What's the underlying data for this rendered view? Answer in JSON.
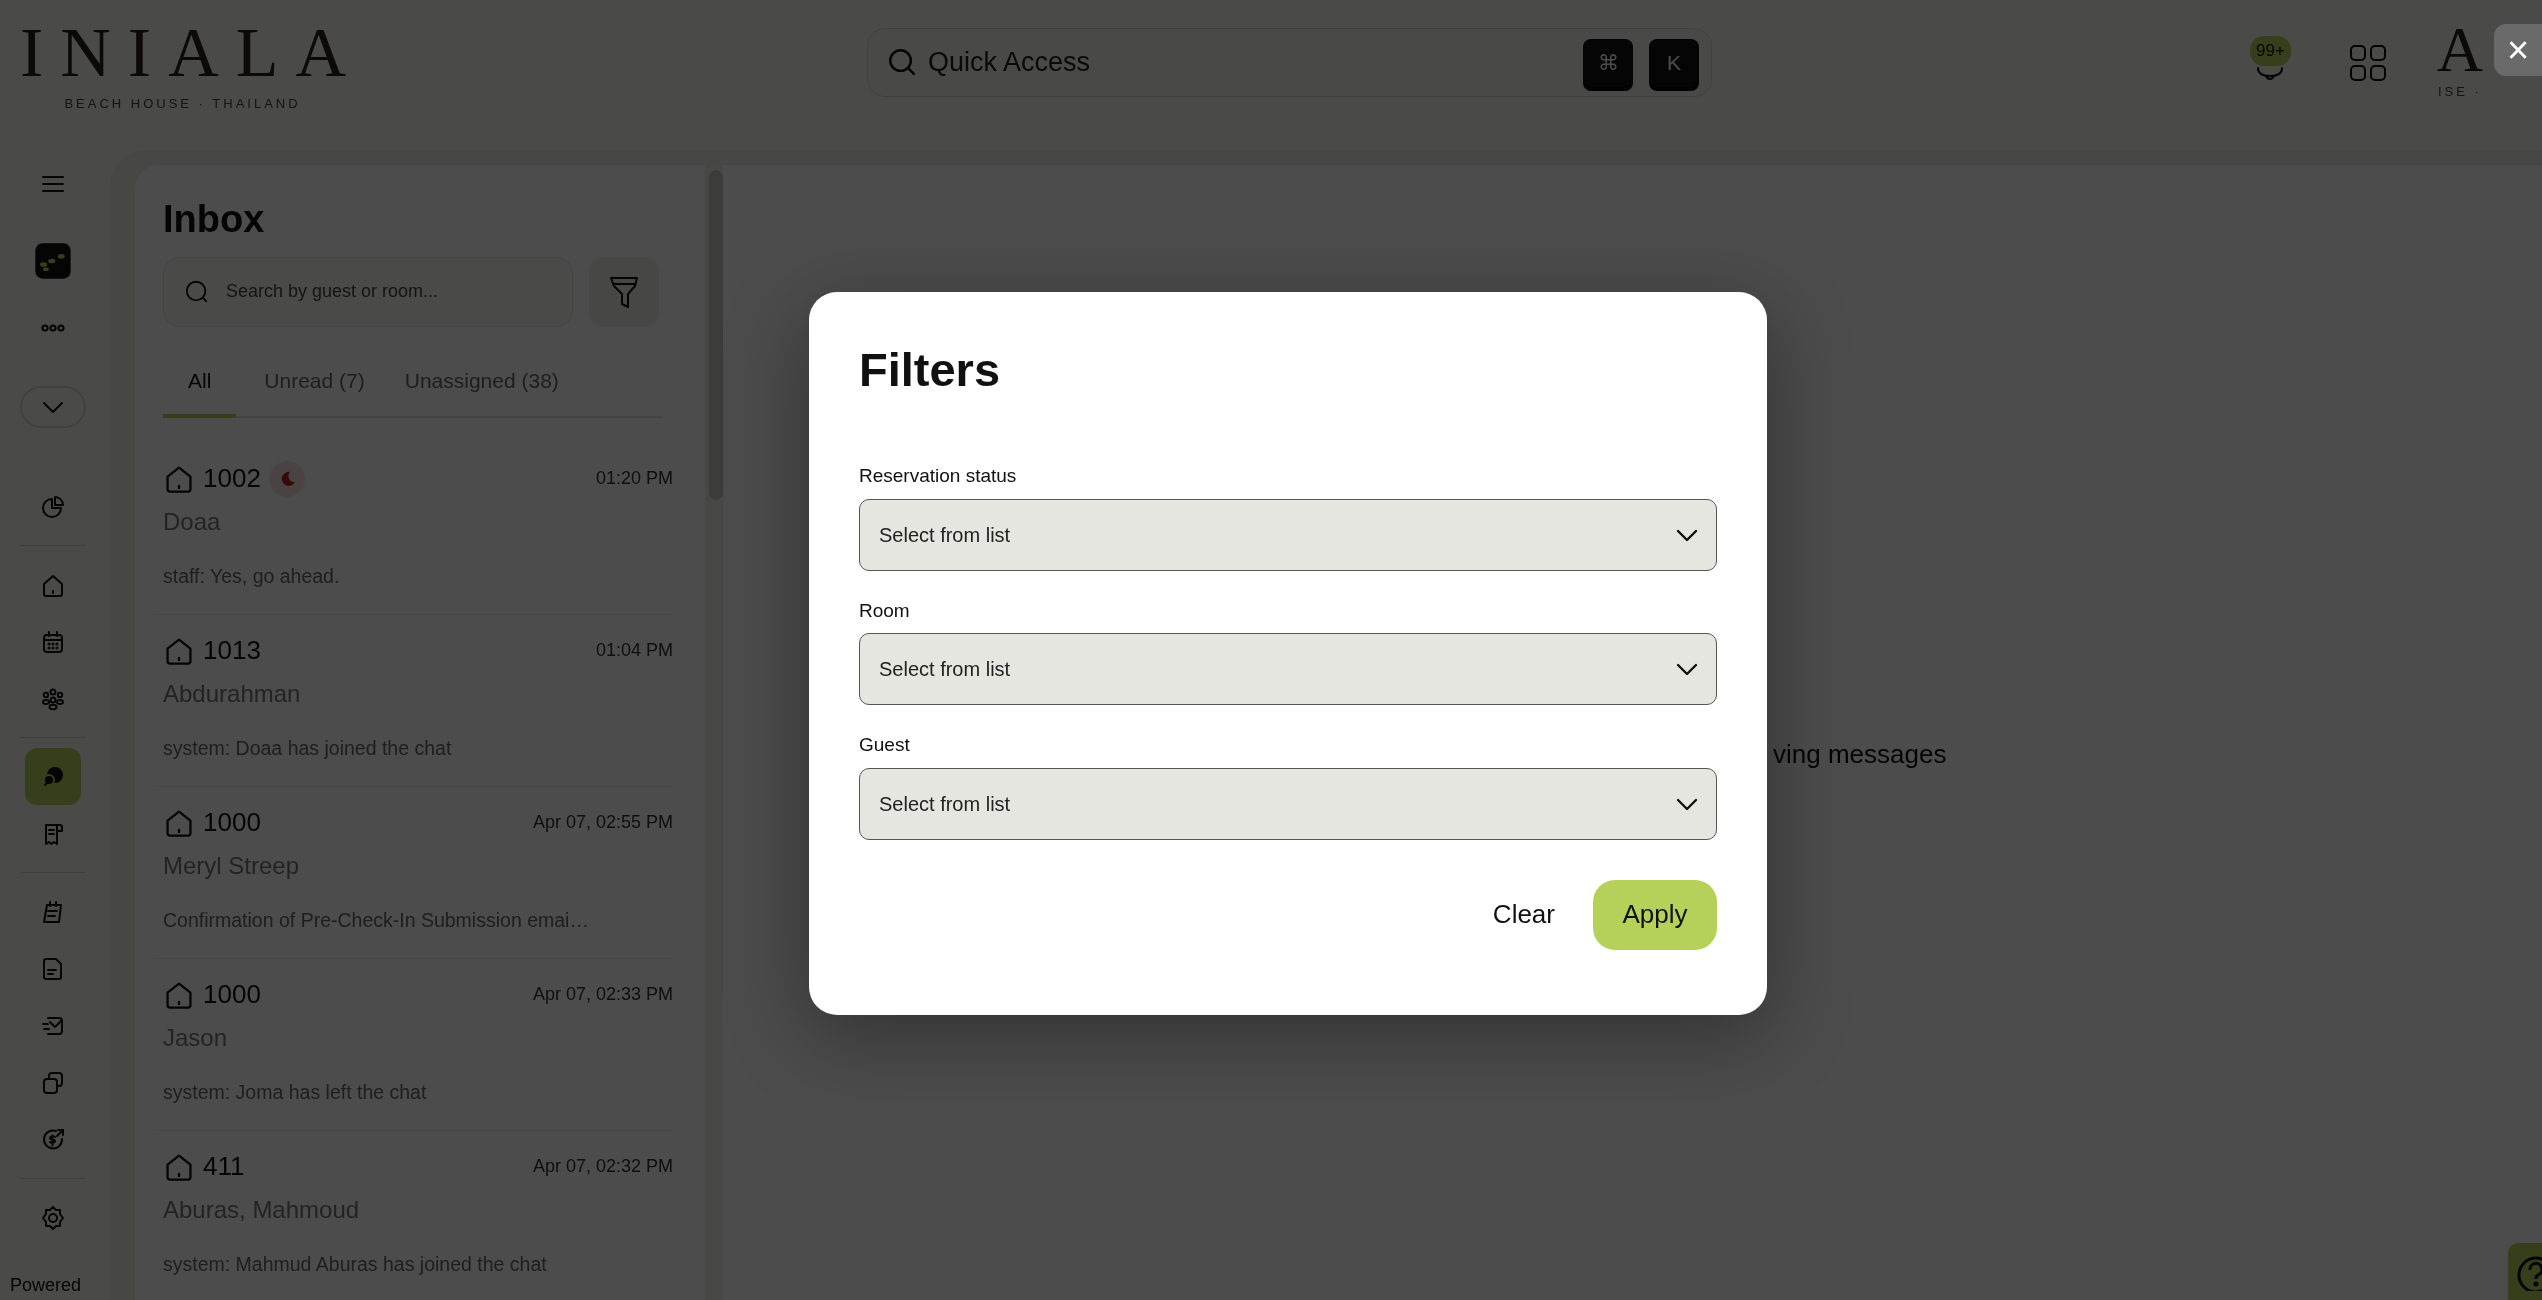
{
  "logo": {
    "name": "INIALA",
    "tagline": "BEACH HOUSE · THAILAND"
  },
  "quick_access": {
    "placeholder": "Quick Access",
    "keys": [
      "⌘",
      "K"
    ]
  },
  "header_right": {
    "notification_badge": "99+",
    "partial_logo_letter": "A",
    "partial_logo_tagline": "ISE ·"
  },
  "close_button": "×",
  "sidebar": {
    "items": [
      {
        "kind": "menu",
        "selected": false
      },
      {
        "kind": "app",
        "selected": false
      },
      {
        "kind": "more",
        "selected": false
      },
      {
        "kind": "collapse"
      },
      {
        "kind": "chart",
        "selected": false
      },
      {
        "kind": "divider"
      },
      {
        "kind": "home",
        "selected": false
      },
      {
        "kind": "calendar",
        "selected": false
      },
      {
        "kind": "guests",
        "selected": false
      },
      {
        "kind": "divider"
      },
      {
        "kind": "chat",
        "selected": true
      },
      {
        "kind": "receipt",
        "selected": false
      },
      {
        "kind": "divider"
      },
      {
        "kind": "notes",
        "selected": false
      },
      {
        "kind": "document",
        "selected": false
      },
      {
        "kind": "mail",
        "selected": false
      },
      {
        "kind": "copy",
        "selected": false
      },
      {
        "kind": "payment",
        "selected": false
      },
      {
        "kind": "divider"
      },
      {
        "kind": "settings",
        "selected": false
      }
    ],
    "footer": "Powered"
  },
  "inbox": {
    "title": "Inbox",
    "search": {
      "placeholder": "Search by guest or room..."
    },
    "tabs": [
      {
        "label": "All",
        "selected": true
      },
      {
        "label": "Unread (7)",
        "selected": false
      },
      {
        "label": "Unassigned (38)",
        "selected": false
      }
    ],
    "conversations": [
      {
        "room": "1002",
        "night_badge": true,
        "time": "01:20 PM",
        "guest": "Doaa",
        "preview": "staff: Yes, go ahead."
      },
      {
        "room": "1013",
        "night_badge": false,
        "time": "01:04 PM",
        "guest": "Abdurahman",
        "preview": "system: Doaa has joined the chat"
      },
      {
        "room": "1000",
        "night_badge": false,
        "time": "Apr 07, 02:55 PM",
        "guest": "Meryl Streep",
        "preview": "Confirmation of Pre-Check-In Submission emai…"
      },
      {
        "room": "1000",
        "night_badge": false,
        "time": "Apr 07, 02:33 PM",
        "guest": "Jason",
        "preview": "system: Joma has left the chat"
      },
      {
        "room": "411",
        "night_badge": false,
        "time": "Apr 07, 02:32 PM",
        "guest": "Aburas, Mahmoud",
        "preview": "system: Mahmud Aburas has joined the chat"
      }
    ]
  },
  "main": {
    "hint": "ving messages"
  },
  "modal": {
    "title": "Filters",
    "fields": [
      {
        "label": "Reservation status",
        "placeholder": "Select from list"
      },
      {
        "label": "Room",
        "placeholder": "Select from list"
      },
      {
        "label": "Guest",
        "placeholder": "Select from list"
      }
    ],
    "buttons": [
      {
        "label": "Clear",
        "kind": "text"
      },
      {
        "label": "Apply",
        "kind": "primary"
      }
    ]
  }
}
